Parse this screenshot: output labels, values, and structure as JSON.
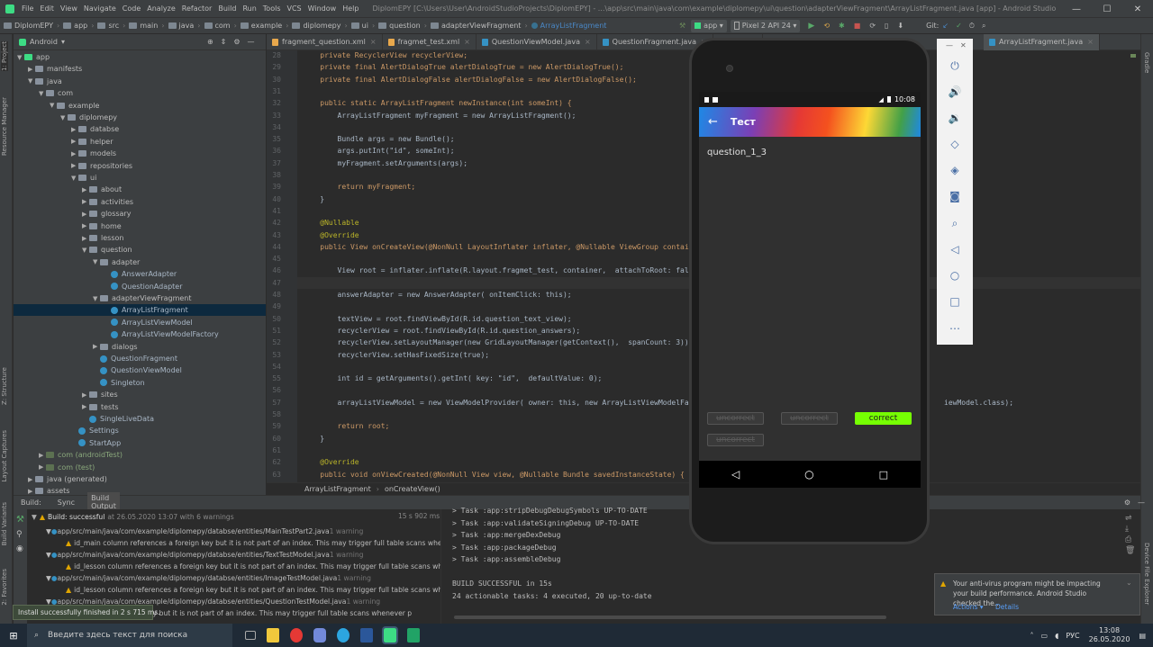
{
  "menu": {
    "items": [
      "File",
      "Edit",
      "View",
      "Navigate",
      "Code",
      "Analyze",
      "Refactor",
      "Build",
      "Run",
      "Tools",
      "VCS",
      "Window",
      "Help"
    ],
    "title": "DiplomEPY [C:\\Users\\User\\AndroidStudioProjects\\DiplomEPY] - ...\\app\\src\\main\\java\\com\\example\\diplomepy\\ui\\question\\adapterViewFragment\\ArrayListFragment.java [app] - Android Studio"
  },
  "nav": {
    "breadcrumbs": [
      "DiplomEPY",
      "app",
      "src",
      "main",
      "java",
      "com",
      "example",
      "diplomepy",
      "ui",
      "question",
      "adapterViewFragment",
      "ArrayListFragment"
    ],
    "run_config": "app",
    "device": "Pixel 2 API 24",
    "git": "Git:"
  },
  "left_strip": [
    "1: Project",
    "Resource Manager",
    "Z: Structure",
    "Layout Captures",
    "Build Variants",
    "2: Favorites"
  ],
  "right_strip": [
    "Gradle",
    "Device File Explorer"
  ],
  "project": {
    "view": "Android",
    "tree": [
      {
        "label": "app",
        "depth": 0,
        "arrow": "▼",
        "kind": "folder"
      },
      {
        "label": "manifests",
        "depth": 1,
        "arrow": "▶",
        "kind": "folder"
      },
      {
        "label": "java",
        "depth": 1,
        "arrow": "▼",
        "kind": "folder"
      },
      {
        "label": "com",
        "depth": 2,
        "arrow": "▼",
        "kind": "folder"
      },
      {
        "label": "example",
        "depth": 3,
        "arrow": "▼",
        "kind": "folder"
      },
      {
        "label": "diplomepy",
        "depth": 4,
        "arrow": "▼",
        "kind": "folder"
      },
      {
        "label": "databse",
        "depth": 5,
        "arrow": "▶",
        "kind": "folder"
      },
      {
        "label": "helper",
        "depth": 5,
        "arrow": "▶",
        "kind": "folder"
      },
      {
        "label": "models",
        "depth": 5,
        "arrow": "▶",
        "kind": "folder"
      },
      {
        "label": "repositories",
        "depth": 5,
        "arrow": "▶",
        "kind": "folder"
      },
      {
        "label": "ui",
        "depth": 5,
        "arrow": "▼",
        "kind": "folder"
      },
      {
        "label": "about",
        "depth": 6,
        "arrow": "▶",
        "kind": "folder"
      },
      {
        "label": "activities",
        "depth": 6,
        "arrow": "▶",
        "kind": "folder"
      },
      {
        "label": "glossary",
        "depth": 6,
        "arrow": "▶",
        "kind": "folder"
      },
      {
        "label": "home",
        "depth": 6,
        "arrow": "▶",
        "kind": "folder"
      },
      {
        "label": "lesson",
        "depth": 6,
        "arrow": "▶",
        "kind": "folder"
      },
      {
        "label": "question",
        "depth": 6,
        "arrow": "▼",
        "kind": "folder"
      },
      {
        "label": "adapter",
        "depth": 7,
        "arrow": "▼",
        "kind": "folder"
      },
      {
        "label": "AnswerAdapter",
        "depth": 8,
        "arrow": "",
        "kind": "class"
      },
      {
        "label": "QuestionAdapter",
        "depth": 8,
        "arrow": "",
        "kind": "class"
      },
      {
        "label": "adapterViewFragment",
        "depth": 7,
        "arrow": "▼",
        "kind": "folder"
      },
      {
        "label": "ArrayListFragment",
        "depth": 8,
        "arrow": "",
        "kind": "class",
        "selected": true
      },
      {
        "label": "ArrayListViewModel",
        "depth": 8,
        "arrow": "",
        "kind": "class"
      },
      {
        "label": "ArrayListViewModelFactory",
        "depth": 8,
        "arrow": "",
        "kind": "class"
      },
      {
        "label": "dialogs",
        "depth": 7,
        "arrow": "▶",
        "kind": "folder"
      },
      {
        "label": "QuestionFragment",
        "depth": 7,
        "arrow": "",
        "kind": "class"
      },
      {
        "label": "QuestionViewModel",
        "depth": 7,
        "arrow": "",
        "kind": "class"
      },
      {
        "label": "Singleton",
        "depth": 7,
        "arrow": "",
        "kind": "class"
      },
      {
        "label": "sites",
        "depth": 6,
        "arrow": "▶",
        "kind": "folder"
      },
      {
        "label": "tests",
        "depth": 6,
        "arrow": "▶",
        "kind": "folder"
      },
      {
        "label": "SingleLiveData",
        "depth": 6,
        "arrow": "",
        "kind": "class"
      },
      {
        "label": "Settings",
        "depth": 5,
        "arrow": "",
        "kind": "class"
      },
      {
        "label": "StartApp",
        "depth": 5,
        "arrow": "",
        "kind": "class"
      },
      {
        "label": "com (androidTest)",
        "depth": 2,
        "arrow": "▶",
        "kind": "folder",
        "tinted": true
      },
      {
        "label": "com (test)",
        "depth": 2,
        "arrow": "▶",
        "kind": "folder",
        "tinted": true
      },
      {
        "label": "java (generated)",
        "depth": 1,
        "arrow": "▶",
        "kind": "folder"
      },
      {
        "label": "assets",
        "depth": 1,
        "arrow": "▶",
        "kind": "folder"
      }
    ]
  },
  "editor": {
    "tabs": [
      {
        "label": "fragment_question.xml",
        "color": "#e8a84c"
      },
      {
        "label": "fragmet_test.xml",
        "color": "#e8a84c"
      },
      {
        "label": "QuestionViewModel.java",
        "color": "#3592c4"
      },
      {
        "label": "QuestionFragment.java",
        "color": "#3592c4"
      },
      {
        "label": "Singl",
        "color": "#3592c4"
      },
      {
        "label": "ArrayListFragment.java",
        "color": "#3592c4"
      }
    ],
    "lines": [
      {
        "n": "28",
        "t": "    private RecyclerView recyclerView;"
      },
      {
        "n": "29",
        "t": "    private final AlertDialogTrue alertDialogTrue = new AlertDialogTrue();"
      },
      {
        "n": "30",
        "t": "    private final AlertDialogFalse alertDialogFalse = new AlertDialogFalse();"
      },
      {
        "n": "31",
        "t": ""
      },
      {
        "n": "32",
        "t": "    public static ArrayListFragment newInstance(int someInt) {"
      },
      {
        "n": "33",
        "t": "        ArrayListFragment myFragment = new ArrayListFragment();"
      },
      {
        "n": "34",
        "t": ""
      },
      {
        "n": "35",
        "t": "        Bundle args = new Bundle();"
      },
      {
        "n": "36",
        "t": "        args.putInt(\"id\", someInt);"
      },
      {
        "n": "37",
        "t": "        myFragment.setArguments(args);"
      },
      {
        "n": "38",
        "t": ""
      },
      {
        "n": "39",
        "t": "        return myFragment;"
      },
      {
        "n": "40",
        "t": "    }"
      },
      {
        "n": "41",
        "t": ""
      },
      {
        "n": "42",
        "t": "    @Nullable"
      },
      {
        "n": "43",
        "t": "    @Override"
      },
      {
        "n": "44",
        "t": "    public View onCreateView(@NonNull LayoutInflater inflater, @Nullable ViewGroup container"
      },
      {
        "n": "45",
        "t": ""
      },
      {
        "n": "46",
        "t": "        View root = inflater.inflate(R.layout.fragmet_test, container,  attachToRoot: false);"
      },
      {
        "n": "47",
        "t": ""
      },
      {
        "n": "48",
        "t": "        answerAdapter = new AnswerAdapter( onItemClick: this);"
      },
      {
        "n": "49",
        "t": ""
      },
      {
        "n": "50",
        "t": "        textView = root.findViewById(R.id.question_text_view);"
      },
      {
        "n": "51",
        "t": "        recyclerView = root.findViewById(R.id.question_answers);"
      },
      {
        "n": "52",
        "t": "        recyclerView.setLayoutManager(new GridLayoutManager(getContext(),  spanCount: 3));"
      },
      {
        "n": "53",
        "t": "        recyclerView.setHasFixedSize(true);"
      },
      {
        "n": "54",
        "t": ""
      },
      {
        "n": "55",
        "t": "        int id = getArguments().getInt( key: \"id\",  defaultValue: 0);"
      },
      {
        "n": "56",
        "t": ""
      },
      {
        "n": "57",
        "t": "        arrayListViewModel = new ViewModelProvider( owner: this, new ArrayListViewModelFactor"
      },
      {
        "n": "58",
        "t": ""
      },
      {
        "n": "59",
        "t": "        return root;"
      },
      {
        "n": "60",
        "t": "    }"
      },
      {
        "n": "61",
        "t": ""
      },
      {
        "n": "62",
        "t": "    @Override"
      },
      {
        "n": "63",
        "t": "    public void onViewCreated(@NonNull View view, @Nullable Bundle savedInstanceState) {"
      }
    ],
    "line57_tail": "iewModel.class);",
    "breadcrumb": [
      "ArrayListFragment",
      "onCreateView()"
    ]
  },
  "bottom": {
    "tabs": [
      "Build:",
      "Sync",
      "Build Output"
    ],
    "status_title": "Build: successful",
    "status_detail": "at 26.05.2020 13:07 with 6 warnings",
    "duration": "15 s 902 ms",
    "warnings": [
      {
        "file": "app/src/main/java/com/example/diplomepy/databse/entities/MainTestPart2.java",
        "count": "1 warning",
        "msg": "id_main column references a foreign key but it is not part of an index. This may trigger full table scans whenever p"
      },
      {
        "file": "app/src/main/java/com/example/diplomepy/databse/entities/TextTestModel.java",
        "count": "1 warning",
        "msg": "id_lesson column references a foreign key but it is not part of an index. This may trigger full table scans whenever p"
      },
      {
        "file": "app/src/main/java/com/example/diplomepy/databse/entities/ImageTestModel.java",
        "count": "1 warning",
        "msg": "id_lesson column references a foreign key but it is not part of an index. This may trigger full table scans whenever p"
      },
      {
        "file": "app/src/main/java/com/example/diplomepy/databse/entities/QuestionTestModel.java",
        "count": "1 warning",
        "msg": "references a foreign key but it is not part of an index. This may trigger full table scans whenever p"
      }
    ],
    "toast": "Install successfully finished in 2 s 715 ms.",
    "output": [
      "> Task :app:stripDebugDebugSymbols UP-TO-DATE",
      "> Task :app:validateSigningDebug UP-TO-DATE",
      "> Task :app:mergeDexDebug",
      "> Task :app:packageDebug",
      "> Task :app:assembleDebug",
      "",
      "BUILD SUCCESSFUL in 15s",
      "24 actionable tasks: 4 executed, 20 up-to-date"
    ]
  },
  "emulator": {
    "time": "10:08",
    "toolbar_title": "Тест",
    "question": "question_1_3",
    "answers": [
      "uncorrect",
      "uncorrect",
      "correct",
      "uncorrect"
    ],
    "correct_color": "#76ff03"
  },
  "notification": {
    "text": "Your anti-virus program might be impacting your build performance. Android Studio checked the...",
    "actions": "Actions ▾",
    "details": "Details"
  },
  "taskbar": {
    "search_placeholder": "Введите здесь текст для поиска",
    "lang": "РУС",
    "time": "13:08",
    "date": "26.05.2020"
  }
}
